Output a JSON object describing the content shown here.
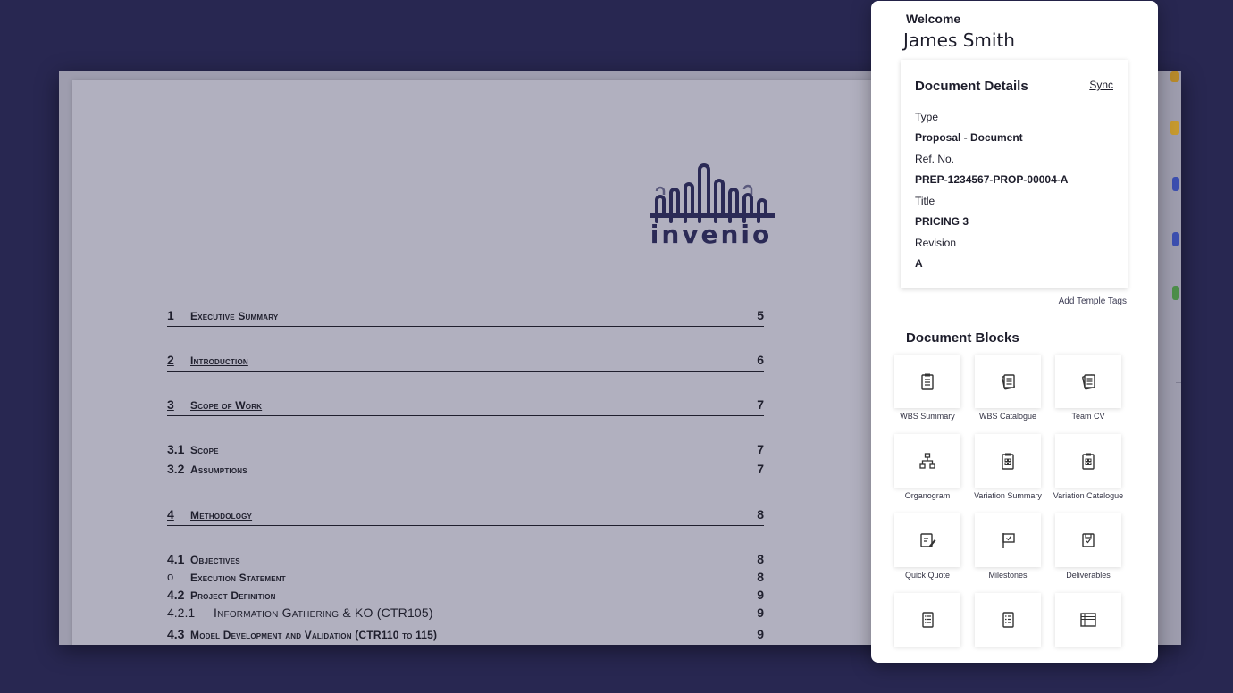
{
  "document": {
    "logo_text": "invenio",
    "toc": [
      {
        "level": "level1",
        "num": "1",
        "title": "Executive Summary",
        "page": "5"
      },
      {
        "level": "level1",
        "num": "2",
        "title": "Introduction",
        "page": "6"
      },
      {
        "level": "level1",
        "num": "3",
        "title": "Scope of Work",
        "page": "7"
      },
      {
        "level": "level2",
        "num": "3.1",
        "title": "Scope",
        "page": "7"
      },
      {
        "level": "level2",
        "num": "3.2",
        "title": "Assumptions",
        "page": "7"
      },
      {
        "level": "level1",
        "num": "4",
        "title": "Methodology",
        "page": "8"
      },
      {
        "level": "level2",
        "num": "4.1",
        "title": "Objectives",
        "page": "8"
      },
      {
        "level": "bullet",
        "num": "o",
        "title": "Execution Statement",
        "page": "8"
      },
      {
        "level": "level2",
        "num": "4.2",
        "title": "Project Definition",
        "page": "9"
      },
      {
        "level": "level3",
        "num": "4.2.1",
        "title": "Information Gathering & KO (CTR105)",
        "page": "9"
      },
      {
        "level": "level2",
        "num": "4.3",
        "title": "Model Development and Validation (CTR110 to 115)",
        "page": "9"
      }
    ]
  },
  "panel": {
    "welcome": "Welcome",
    "user_name": "James Smith",
    "details": {
      "title": "Document Details",
      "sync": "Sync",
      "type_label": "Type",
      "type_value": "Proposal - Document",
      "ref_label": "Ref. No.",
      "ref_value": "PREP-1234567-PROP-00004-A",
      "title_label": "Title",
      "title_value": "PRICING 3",
      "revision_label": "Revision",
      "revision_value": "A"
    },
    "add_tags": "Add Temple Tags",
    "blocks_title": "Document Blocks",
    "blocks": [
      {
        "label": "WBS Summary",
        "icon": "clipboard-list-icon"
      },
      {
        "label": "WBS Catalogue",
        "icon": "document-stack-icon"
      },
      {
        "label": "Team CV",
        "icon": "document-stack-icon"
      },
      {
        "label": "Organogram",
        "icon": "org-chart-icon"
      },
      {
        "label": "Variation Summary",
        "icon": "clipboard-grid-icon"
      },
      {
        "label": "Variation Catalogue",
        "icon": "clipboard-grid-icon"
      },
      {
        "label": "Quick Quote",
        "icon": "quote-edit-icon"
      },
      {
        "label": "Milestones",
        "icon": "flag-icon"
      },
      {
        "label": "Deliverables",
        "icon": "package-icon"
      },
      {
        "label": "",
        "icon": "checklist-icon"
      },
      {
        "label": "",
        "icon": "checklist-icon"
      },
      {
        "label": "",
        "icon": "table-icon"
      }
    ]
  },
  "colors": {
    "background": "#282751",
    "page": "#b1b0bf",
    "brand": "#2b2a56"
  }
}
